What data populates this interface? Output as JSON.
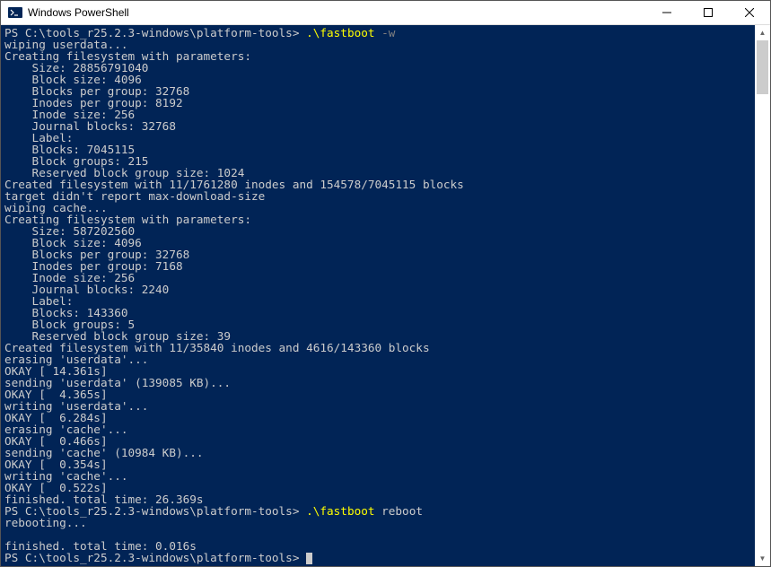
{
  "window": {
    "title": "Windows PowerShell"
  },
  "prompt1": {
    "path": "PS C:\\tools_r25.2.3-windows\\platform-tools> ",
    "cmd": ".\\fastboot",
    "args": " -w"
  },
  "output1": [
    "wiping userdata...",
    "Creating filesystem with parameters:",
    "    Size: 28856791040",
    "    Block size: 4096",
    "    Blocks per group: 32768",
    "    Inodes per group: 8192",
    "    Inode size: 256",
    "    Journal blocks: 32768",
    "    Label:",
    "    Blocks: 7045115",
    "    Block groups: 215",
    "    Reserved block group size: 1024",
    "Created filesystem with 11/1761280 inodes and 154578/7045115 blocks",
    "target didn't report max-download-size",
    "wiping cache...",
    "Creating filesystem with parameters:",
    "    Size: 587202560",
    "    Block size: 4096",
    "    Blocks per group: 32768",
    "    Inodes per group: 7168",
    "    Inode size: 256",
    "    Journal blocks: 2240",
    "    Label:",
    "    Blocks: 143360",
    "    Block groups: 5",
    "    Reserved block group size: 39",
    "Created filesystem with 11/35840 inodes and 4616/143360 blocks",
    "erasing 'userdata'...",
    "OKAY [ 14.361s]",
    "sending 'userdata' (139085 KB)...",
    "OKAY [  4.365s]",
    "writing 'userdata'...",
    "OKAY [  6.284s]",
    "erasing 'cache'...",
    "OKAY [  0.466s]",
    "sending 'cache' (10984 KB)...",
    "OKAY [  0.354s]",
    "writing 'cache'...",
    "OKAY [  0.522s]",
    "finished. total time: 26.369s"
  ],
  "prompt2": {
    "path": "PS C:\\tools_r25.2.3-windows\\platform-tools> ",
    "cmd": ".\\fastboot",
    "args": " reboot"
  },
  "output2": [
    "rebooting...",
    "",
    "finished. total time: 0.016s"
  ],
  "prompt3": {
    "path": "PS C:\\tools_r25.2.3-windows\\platform-tools> "
  }
}
